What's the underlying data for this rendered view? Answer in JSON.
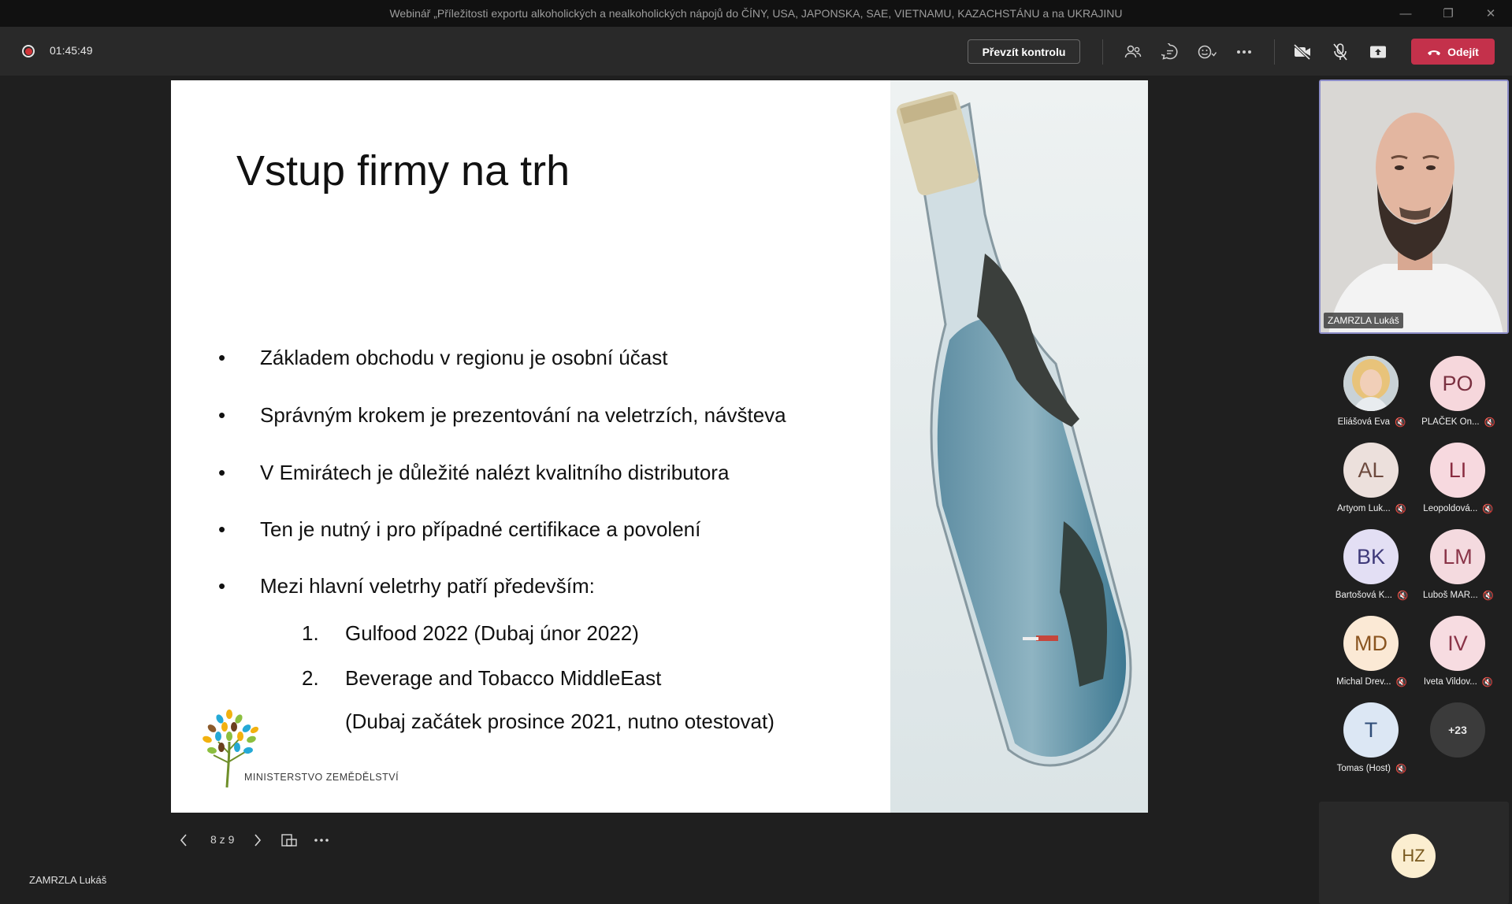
{
  "window": {
    "title": "Webinář „Příležitosti exportu alkoholických a nealkoholických nápojů do ČÍNY, USA, JAPONSKA, SAE, VIETNAMU, KAZACHSTÁNU a na UKRAJINU"
  },
  "toolbar": {
    "timer": "01:45:49",
    "take_control_label": "Převzít kontrolu",
    "leave_label": "Odejít",
    "colors": {
      "leave": "#c4314b",
      "record": "#d13438"
    },
    "icons": [
      "people-icon",
      "chat-icon",
      "reactions-icon",
      "more-icon",
      "camera-off-icon",
      "mic-off-icon",
      "share-icon",
      "phone-icon"
    ]
  },
  "slide": {
    "title": "Vstup firmy na trh",
    "bullets": [
      "Základem obchodu v regionu je osobní účast",
      "Správným krokem je prezentování na veletrzích, návšteva",
      "V Emirátech je důležité nalézt kvalitního distributora",
      "Ten je nutný i pro případné certifikace a povolení",
      "Mezi hlavní veletrhy patří především:"
    ],
    "bullet_glyph": "•",
    "numbered": [
      {
        "num": "1.",
        "text": "Gulfood 2022 (Dubaj únor 2022)"
      },
      {
        "num": "2.",
        "text": "Beverage and Tobacco MiddleEast"
      }
    ],
    "numbered_continuation": "(Dubaj začátek prosince 2021, nutno otestovat)",
    "logo_text": "MINISTERSTVO ZEMĚDĚLSTVÍ"
  },
  "slide_nav": {
    "counter": "8 z 9"
  },
  "presenter": {
    "name": "ZAMRZLA Lukáš"
  },
  "participants": {
    "video_name": "ZAMRZLA Lukáš",
    "list": [
      {
        "initials": "",
        "name": "Eliášová Eva",
        "photo": true
      },
      {
        "initials": "PO",
        "name": "PLAČEK On...",
        "bg": "#f6d7dc",
        "fg": "#7a3040"
      },
      {
        "initials": "AL",
        "name": "Artyom Luk...",
        "bg": "#ece0dc",
        "fg": "#6d4a3e"
      },
      {
        "initials": "LI",
        "name": "Leopoldová...",
        "bg": "#f7d9df",
        "fg": "#8a2c40"
      },
      {
        "initials": "BK",
        "name": "Bartošová K...",
        "bg": "#e3dff4",
        "fg": "#3f3a7a"
      },
      {
        "initials": "LM",
        "name": "Luboš MAR...",
        "bg": "#f4dadf",
        "fg": "#8a3448"
      },
      {
        "initials": "MD",
        "name": "Michal Drev...",
        "bg": "#fbe9d5",
        "fg": "#8a5520"
      },
      {
        "initials": "IV",
        "name": "Iveta Vildov...",
        "bg": "#f7dce1",
        "fg": "#8a3448"
      },
      {
        "initials": "T",
        "name": "Tomas (Host)",
        "bg": "#dce7f4",
        "fg": "#2f4d78"
      }
    ],
    "overflow": "+23",
    "bottom_initials": "HZ"
  }
}
